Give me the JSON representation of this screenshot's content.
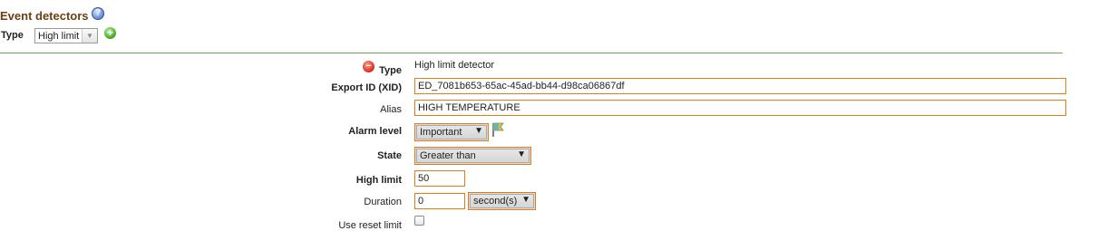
{
  "header": {
    "title": "Event detectors",
    "help_icon": "help-icon",
    "type_label": "Type",
    "type_select_value": "High limit",
    "add_icon": "add-icon"
  },
  "detector": {
    "delete_icon": "delete-icon",
    "type_label": "Type",
    "type_value": "High limit detector",
    "xid_label": "Export ID (XID)",
    "xid_value": "ED_7081b653-65ac-45ad-bb44-d98ca06867df",
    "alias_label": "Alias",
    "alias_value": "HIGH TEMPERATURE",
    "alarm_label": "Alarm level",
    "alarm_value": "Important",
    "alarm_flag_icon": "flag-icon",
    "state_label": "State",
    "state_value": "Greater than",
    "limit_label": "High limit",
    "limit_value": "50",
    "duration_label": "Duration",
    "duration_value": "0",
    "duration_unit": "second(s)",
    "reset_label": "Use reset limit",
    "reset_checked": false
  },
  "colors": {
    "title": "#6b3f12",
    "field_border": "#e07d18",
    "divider": "#6aa84f"
  }
}
